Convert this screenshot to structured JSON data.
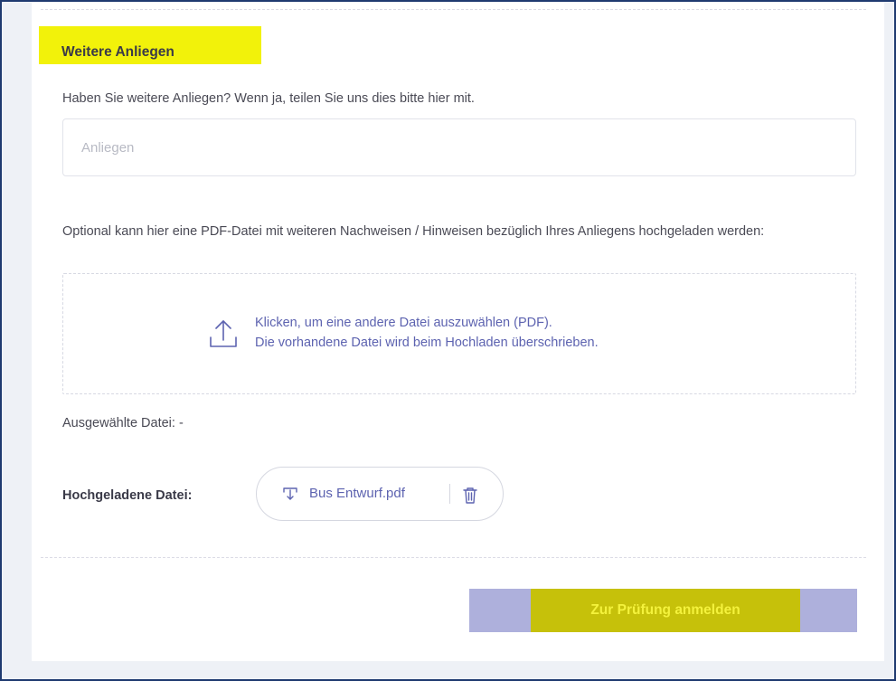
{
  "section": {
    "title": "Weitere Anliegen",
    "question": "Haben Sie weitere Anliegen? Wenn ja, teilen Sie uns dies bitte hier mit.",
    "anliegen_input": {
      "value": "",
      "placeholder": "Anliegen"
    }
  },
  "upload": {
    "optional_text": "Optional kann hier eine PDF-Datei mit weiteren Nachweisen / Hinweisen bezüglich Ihres Anliegens hochgeladen werden:",
    "dropzone_line1": "Klicken, um eine andere Datei auszuwählen (PDF).",
    "dropzone_line2": "Die vorhandene Datei wird beim Hochladen überschrieben.",
    "upload_icon": "upload-icon",
    "selected_file": "Ausgewählte Datei: -",
    "uploaded_label": "Hochgeladene Datei:",
    "uploaded_file_name": "Bus Entwurf.pdf",
    "file_icon": "download-icon",
    "delete_icon": "trash-icon"
  },
  "actions": {
    "submit_label": "Zur Prüfung anmelden"
  },
  "colors": {
    "highlight_yellow": "#f2f20a",
    "button_background": "#aeb0dc",
    "button_highlight": "#c6c10a",
    "link_purple": "#5d63b0",
    "frame_border": "#1f3a70"
  }
}
